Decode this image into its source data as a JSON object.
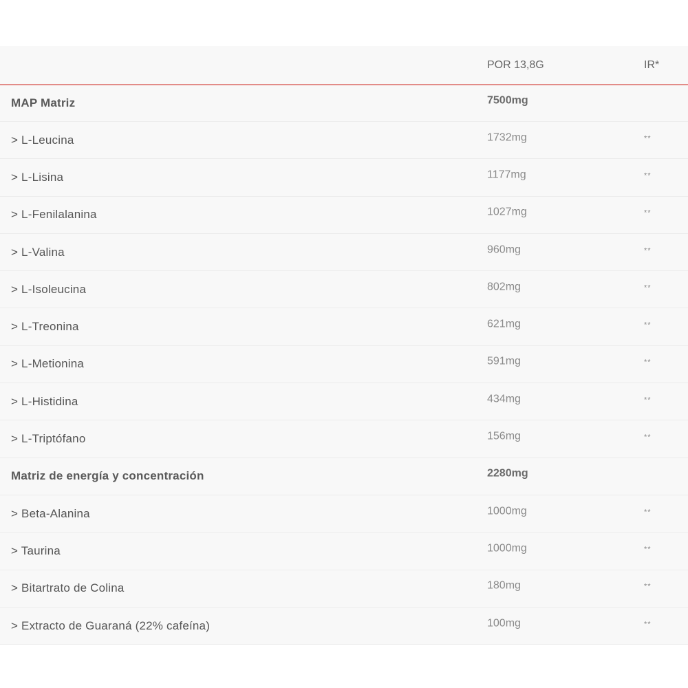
{
  "header": {
    "col_amount": "POR 13,8G",
    "col_ir": "IR*"
  },
  "rows": [
    {
      "type": "group",
      "name": "MAP Matriz",
      "amount": "7500mg",
      "ir": ""
    },
    {
      "type": "item",
      "name": "> L-Leucina",
      "amount": "1732mg",
      "ir": "**"
    },
    {
      "type": "item",
      "name": "> L-Lisina",
      "amount": "1177mg",
      "ir": "**"
    },
    {
      "type": "item",
      "name": "> L-Fenilalanina",
      "amount": "1027mg",
      "ir": "**"
    },
    {
      "type": "item",
      "name": "> L-Valina",
      "amount": "960mg",
      "ir": "**"
    },
    {
      "type": "item",
      "name": "> L-Isoleucina",
      "amount": "802mg",
      "ir": "**"
    },
    {
      "type": "item",
      "name": "> L-Treonina",
      "amount": "621mg",
      "ir": "**"
    },
    {
      "type": "item",
      "name": "> L-Metionina",
      "amount": "591mg",
      "ir": "**"
    },
    {
      "type": "item",
      "name": "> L-Histidina",
      "amount": "434mg",
      "ir": "**"
    },
    {
      "type": "item",
      "name": "> L-Triptófano",
      "amount": "156mg",
      "ir": "**"
    },
    {
      "type": "group",
      "name": "Matriz de energía y concentración",
      "amount": "2280mg",
      "ir": ""
    },
    {
      "type": "item",
      "name": "> Beta-Alanina",
      "amount": "1000mg",
      "ir": "**"
    },
    {
      "type": "item",
      "name": "> Taurina",
      "amount": "1000mg",
      "ir": "**"
    },
    {
      "type": "item",
      "name": "> Bitartrato de Colina",
      "amount": "180mg",
      "ir": "**"
    },
    {
      "type": "item",
      "name": "> Extracto de Guaraná (22% cafeína)",
      "amount": "100mg",
      "ir": "**"
    }
  ]
}
